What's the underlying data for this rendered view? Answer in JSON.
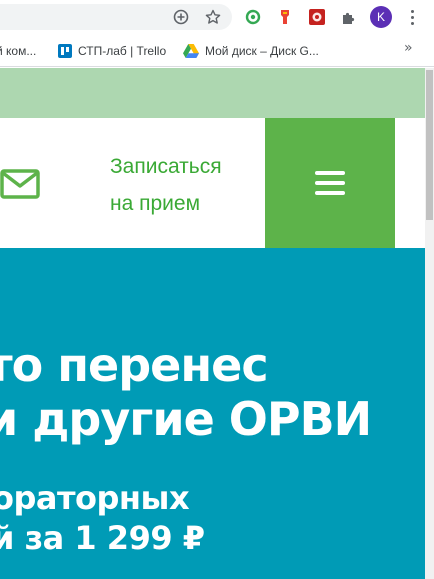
{
  "browser": {
    "profile_initial": "K",
    "bookmarks": [
      {
        "label": "й ком..."
      },
      {
        "label": "СТП-лаб | Trello"
      },
      {
        "label": "Мой диск – Диск G..."
      }
    ],
    "more_bookmarks": "»"
  },
  "page": {
    "appointment_line1": "Записаться",
    "appointment_line2": "на прием",
    "hero_title_line1": "то перенес",
    "hero_title_line2": "и другие ОРВИ",
    "hero_sub_line1": "ораторных",
    "hero_sub_line2": "й за 1 299 ₽"
  },
  "colors": {
    "accent_green": "#5db34a",
    "link_green": "#3aa935",
    "strip_green": "#add7b0",
    "hero_blue": "#009bb6"
  },
  "icons": [
    "zoom-icon",
    "bookmark-star-icon",
    "extension-circle-icon",
    "extension-flag-icon",
    "extension-red-icon",
    "extensions-puzzle-icon",
    "mail-icon",
    "hamburger-menu-icon"
  ]
}
